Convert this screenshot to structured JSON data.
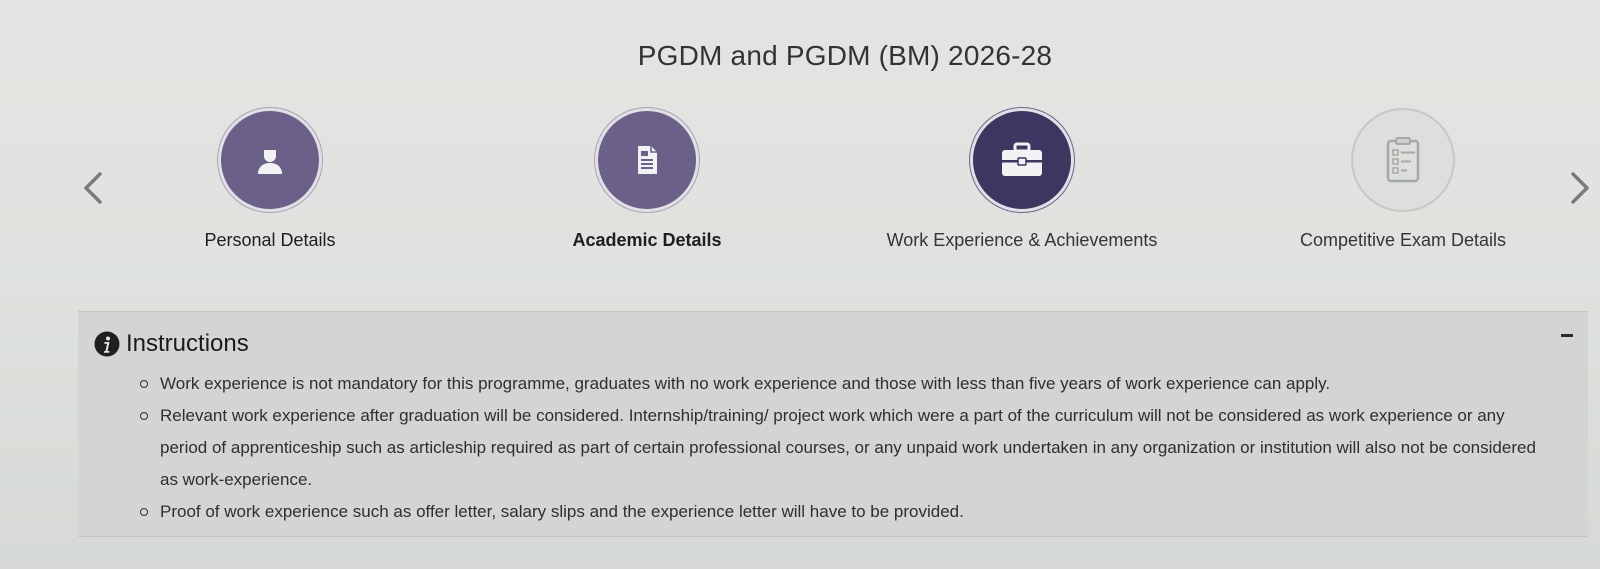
{
  "page_title": "PGDM and PGDM (BM) 2026-28",
  "nav": {
    "prev_icon": "chevron-left-icon",
    "next_icon": "chevron-right-icon"
  },
  "steps": [
    {
      "label": "Personal Details",
      "icon": "user-icon",
      "state": "completed"
    },
    {
      "label": "Academic Details",
      "icon": "document-icon",
      "state": "completed"
    },
    {
      "label": "Work Experience & Achievements",
      "icon": "briefcase-icon",
      "state": "active"
    },
    {
      "label": "Competitive Exam Details",
      "icon": "clipboard-checklist-icon",
      "state": "pending"
    }
  ],
  "instructions": {
    "title": "Instructions",
    "icon": "info-icon",
    "collapse_icon": "minus-icon",
    "items": [
      "Work experience is not mandatory for this programme, graduates with no work experience and those with less than five years of work experience can apply.",
      "Relevant work experience after graduation will be considered. Internship/training/ project work which were a part of the curriculum will not be considered as work experience or any period of apprenticeship such as articleship required as part of certain professional courses, or any unpaid work undertaken in any organization or institution will also not be considered as work-experience.",
      "Proof of work experience such as offer letter, salary slips and the experience letter will have to be provided."
    ]
  },
  "colors": {
    "completed": "#6b6088",
    "active": "#3e3560",
    "pending": "#dcdfdb"
  }
}
